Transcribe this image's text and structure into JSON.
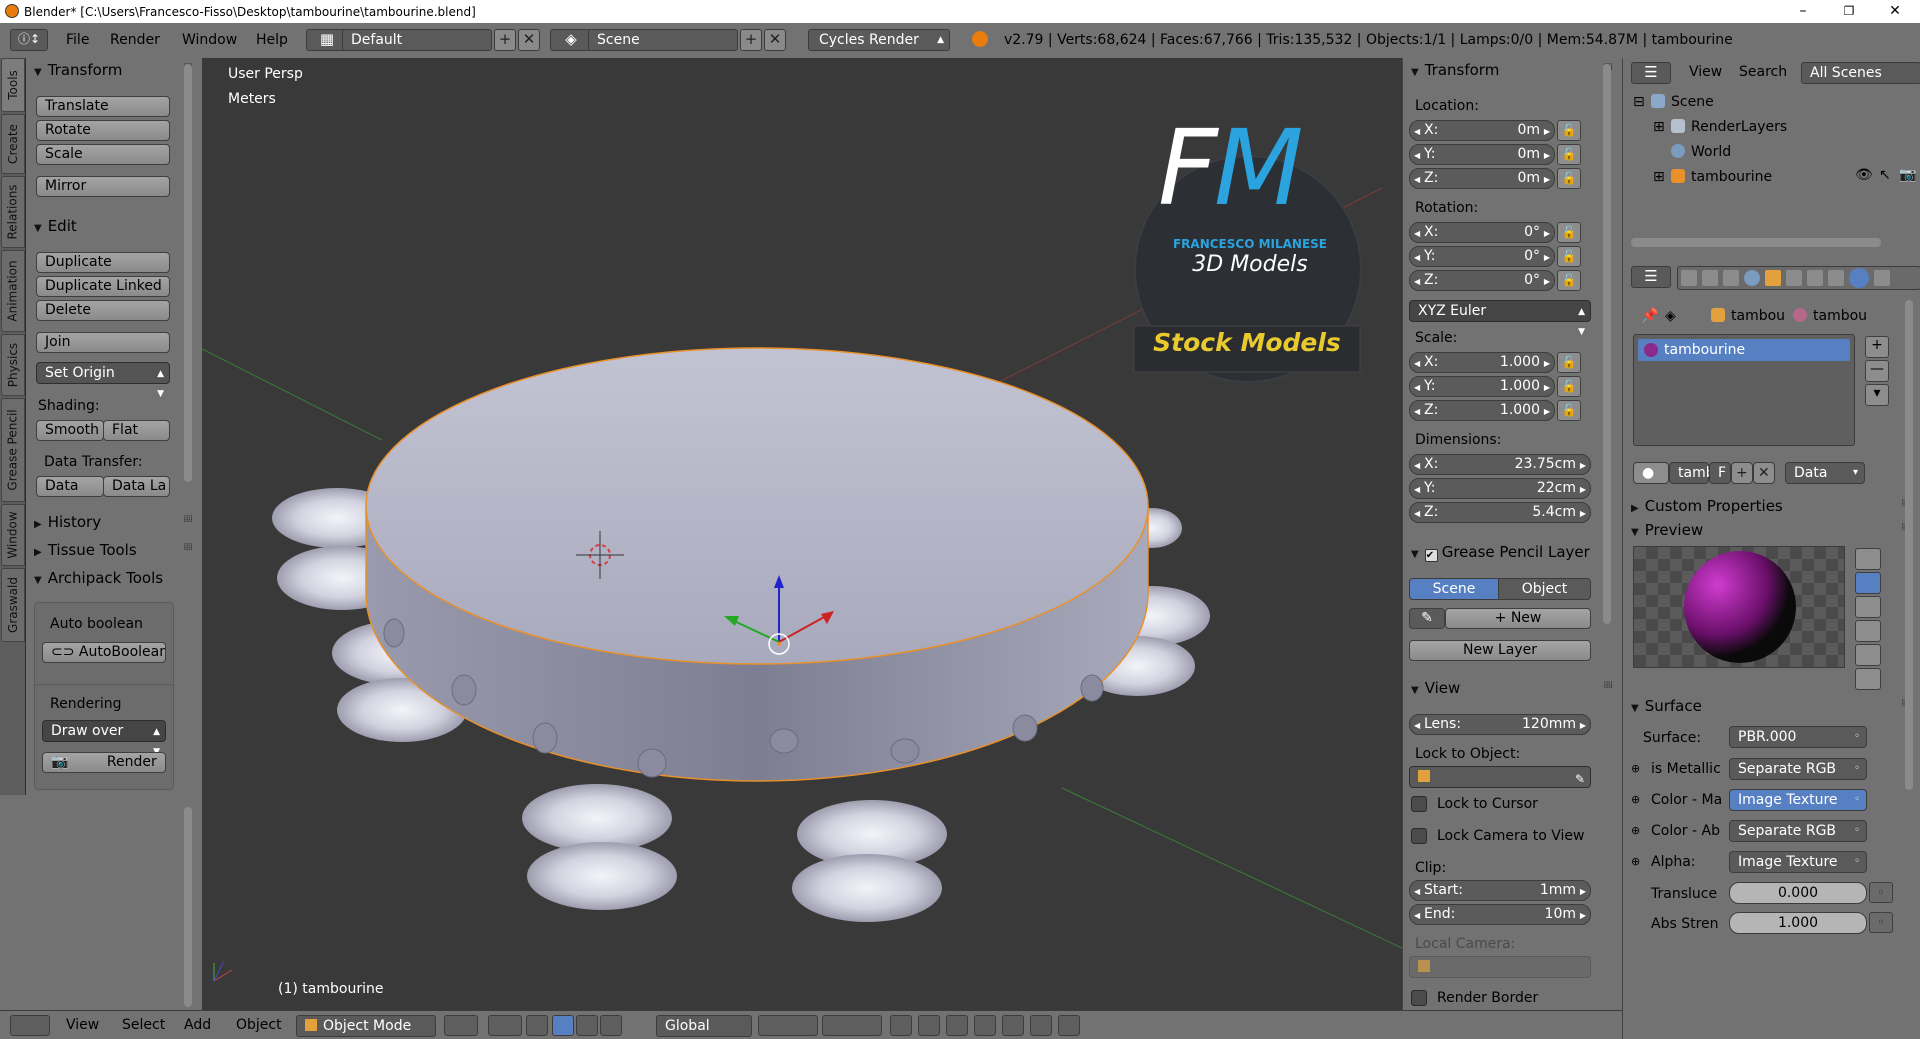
{
  "window": {
    "title": "Blender* [C:\\Users\\Francesco-Fisso\\Desktop\\tambourine\\tambourine.blend]",
    "controls": [
      "–",
      "❐",
      "✕"
    ]
  },
  "info_header": {
    "menus": [
      "File",
      "Render",
      "Window",
      "Help"
    ],
    "screen_layout": "Default",
    "scene": "Scene",
    "render_engine": "Cycles Render",
    "stats": "v2.79 | Verts:68,624 | Faces:67,766 | Tris:135,532 | Objects:1/1 | Lamps:0/0 | Mem:54.87M | tambourine"
  },
  "tool_tabs": [
    "Tools",
    "Create",
    "Relations",
    "Animation",
    "Physics",
    "Grease Pencil",
    "Window",
    "Graswald"
  ],
  "tool_shelf": {
    "transform": {
      "title": "Transform",
      "buttons": [
        "Translate",
        "Rotate",
        "Scale",
        "Mirror"
      ]
    },
    "edit": {
      "title": "Edit",
      "buttons": [
        "Duplicate",
        "Duplicate Linked",
        "Delete",
        "Join"
      ],
      "set_origin": "Set Origin",
      "shading_label": "Shading:",
      "shading": [
        "Smooth",
        "Flat"
      ],
      "data_transfer_label": "Data Transfer:",
      "data_transfer": [
        "Data",
        "Data La"
      ]
    },
    "history": "History",
    "tissue_tools": "Tissue Tools",
    "archipack": {
      "title": "Archipack Tools",
      "auto_boolean_label": "Auto boolean",
      "auto_boolean_btn": "AutoBoolean",
      "rendering_label": "Rendering",
      "draw_over": "Draw over",
      "render_btn": "Render"
    }
  },
  "viewport": {
    "view_name": "User Persp",
    "units": "Meters",
    "object_label": "(1) tambourine",
    "logo": {
      "initials": "FM",
      "author": "FRANCESCO MILANESE",
      "subtitle": "3D Models",
      "banner": "Stock Models"
    }
  },
  "properties_n": {
    "transform_title": "Transform",
    "location_label": "Location:",
    "location": [
      {
        "k": "X:",
        "v": "0m"
      },
      {
        "k": "Y:",
        "v": "0m"
      },
      {
        "k": "Z:",
        "v": "0m"
      }
    ],
    "rotation_label": "Rotation:",
    "rotation": [
      {
        "k": "X:",
        "v": "0°"
      },
      {
        "k": "Y:",
        "v": "0°"
      },
      {
        "k": "Z:",
        "v": "0°"
      }
    ],
    "rotation_mode": "XYZ Euler",
    "scale_label": "Scale:",
    "scale": [
      {
        "k": "X:",
        "v": "1.000"
      },
      {
        "k": "Y:",
        "v": "1.000"
      },
      {
        "k": "Z:",
        "v": "1.000"
      }
    ],
    "dimensions_label": "Dimensions:",
    "dimensions": [
      {
        "k": "X:",
        "v": "23.75cm"
      },
      {
        "k": "Y:",
        "v": "22cm"
      },
      {
        "k": "Z:",
        "v": "5.4cm"
      }
    ],
    "grease_pencil_title": "Grease Pencil Layer",
    "gp_scene": "Scene",
    "gp_object": "Object",
    "gp_new": "New",
    "gp_new_layer": "New Layer",
    "view_title": "View",
    "lens_label": "Lens:",
    "lens": "120mm",
    "lock_to_object": "Lock to Object:",
    "lock_to_cursor": "Lock to Cursor",
    "lock_camera": "Lock Camera to View",
    "clip_label": "Clip:",
    "clip_start_label": "Start:",
    "clip_start": "1mm",
    "clip_end_label": "End:",
    "clip_end": "10m",
    "local_camera": "Local Camera:",
    "render_border": "Render Border"
  },
  "outliner": {
    "view": "View",
    "search": "Search",
    "scenes": "All Scenes",
    "items": [
      "Scene",
      "RenderLayers",
      "World",
      "tambourine"
    ]
  },
  "properties": {
    "breadcrumb": [
      "tambou",
      "tambou"
    ],
    "material_slot": "tambourine",
    "material_name": "tamb",
    "material_f": "F",
    "data_dropdown": "Data",
    "custom_properties": "Custom Properties",
    "preview": "Preview",
    "surface_title": "Surface",
    "surface_label": "Surface:",
    "surface_value": "PBR.000",
    "inputs": [
      {
        "label": "is Metallic",
        "value": "Separate RGB",
        "highlight": false
      },
      {
        "label": "Color - Ma",
        "value": "Image Texture",
        "highlight": true
      },
      {
        "label": "Color - Ab",
        "value": "Separate RGB",
        "highlight": false
      },
      {
        "label": "Alpha:",
        "value": "Image Texture",
        "highlight": false
      }
    ],
    "transluce_label": "Transluce",
    "transluce_value": "0.000",
    "abs_label": "Abs Stren",
    "abs_value": "1.000"
  },
  "bottom_bar": {
    "menus": [
      "View",
      "Select",
      "Add",
      "Object"
    ],
    "mode": "Object Mode",
    "orientation": "Global"
  },
  "colors": {
    "accent_blue": "#5680c2",
    "logo_cyan": "#2aa3df",
    "banner_yellow": "#e8c92e",
    "outline_orange": "#e8902a"
  }
}
